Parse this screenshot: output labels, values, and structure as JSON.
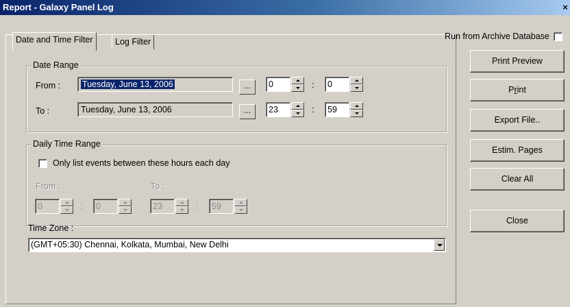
{
  "window": {
    "title": "Report  - Galaxy Panel Log",
    "close_glyph": "×"
  },
  "tabs": [
    {
      "label": "Date and Time Filter",
      "active": true
    },
    {
      "label": "Log Filter",
      "active": false
    }
  ],
  "archive": {
    "label": "Run from Archive Database",
    "checked": false
  },
  "date_range": {
    "title": "Date Range",
    "from_label": "From :",
    "from_date": "Tuesday, June 13, 2006",
    "from_hour": "0",
    "from_minute": "0",
    "to_label": "To :",
    "to_date": "Tuesday, June 13, 2006",
    "to_hour": "23",
    "to_minute": "59",
    "ellipsis": "..."
  },
  "daily_range": {
    "title": "Daily Time Range",
    "checkbox_label": "Only list events between these hours each day",
    "checked": false,
    "from_label": "From :",
    "to_label": "To :",
    "from_hour": "0",
    "from_minute": "0",
    "to_hour": "23",
    "to_minute": "59"
  },
  "time_zone": {
    "label": "Time Zone :",
    "value": "(GMT+05:30) Chennai, Kolkata, Mumbai, New Delhi"
  },
  "buttons": {
    "print_preview": "Print Preview",
    "print_pre": "P",
    "print_ul": "r",
    "print_post": "int",
    "export": "Export File..",
    "estim": "Estim. Pages",
    "clear": "Clear All",
    "close": "Close"
  },
  "colors": {
    "face": "#d4d0c8",
    "title_start": "#0a246a",
    "title_end": "#a6caf0",
    "selection": "#0a246a"
  },
  "icons": {
    "spin_up": "up-arrow-icon",
    "spin_down": "down-arrow-icon",
    "dropdown": "chevron-down-icon"
  }
}
